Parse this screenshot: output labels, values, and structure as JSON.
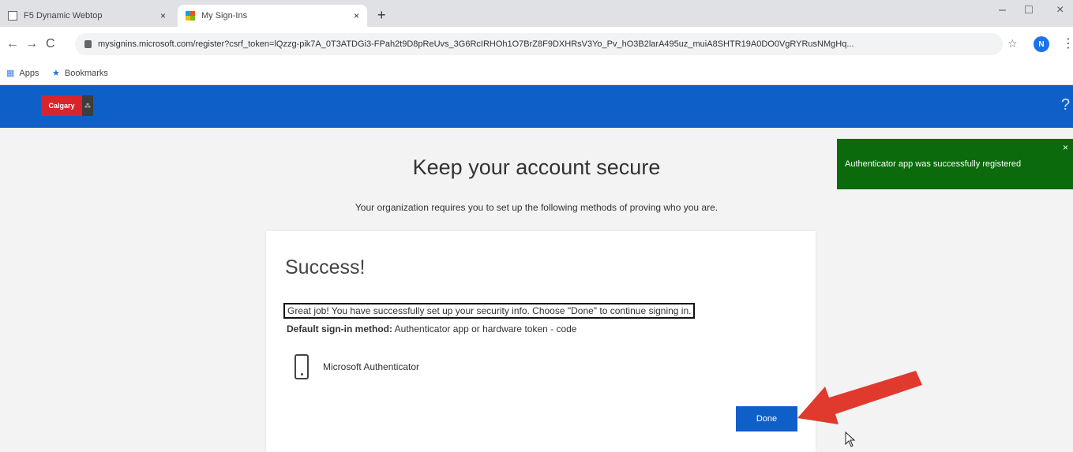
{
  "browser": {
    "tabs": [
      {
        "title": "F5 Dynamic Webtop",
        "close": "×"
      },
      {
        "title": "My Sign-Ins",
        "close": "×"
      }
    ],
    "new_tab": "+",
    "window_controls": [
      "–",
      "□",
      "×"
    ],
    "url": "mysignins.microsoft.com/register?csrf_token=lQzzg-pik7A_0T3ATDGi3-FPah2t9D8pReUvs_3G6RcIRHOh1O7BrZ8F9DXHRsV3Yo_Pv_hO3B2larA495uz_muiA8SHTR19A0DO0VgRYRusNMgHq...",
    "nav": {
      "back": "←",
      "forward": "→",
      "reload": "C"
    },
    "star": "☆",
    "profile_initial": "N",
    "menu": "⋮",
    "bookmarks": [
      {
        "label": "Apps",
        "icon": "apps-grid-icon"
      },
      {
        "label": "Bookmarks",
        "icon": "star-icon"
      }
    ]
  },
  "header": {
    "logo_text": "Calgary",
    "logo_mark": "⁂",
    "help": "?"
  },
  "page": {
    "title": "Keep your account secure",
    "subtitle": "Your organization requires you to set up the following methods of proving who you are."
  },
  "card": {
    "heading": "Success!",
    "message": "Great job! You have successfully set up your security info. Choose \"Done\" to continue signing in.",
    "default_label": "Default sign-in method:",
    "default_value": "Authenticator app or hardware token - code",
    "method_name": "Microsoft Authenticator",
    "done_label": "Done"
  },
  "toast": {
    "message": "Authenticator app was successfully registered",
    "close": "×"
  },
  "colors": {
    "brand_blue": "#0f5fc9",
    "toast_green": "#0b6a0b",
    "arrow_red": "#e03a2e"
  }
}
